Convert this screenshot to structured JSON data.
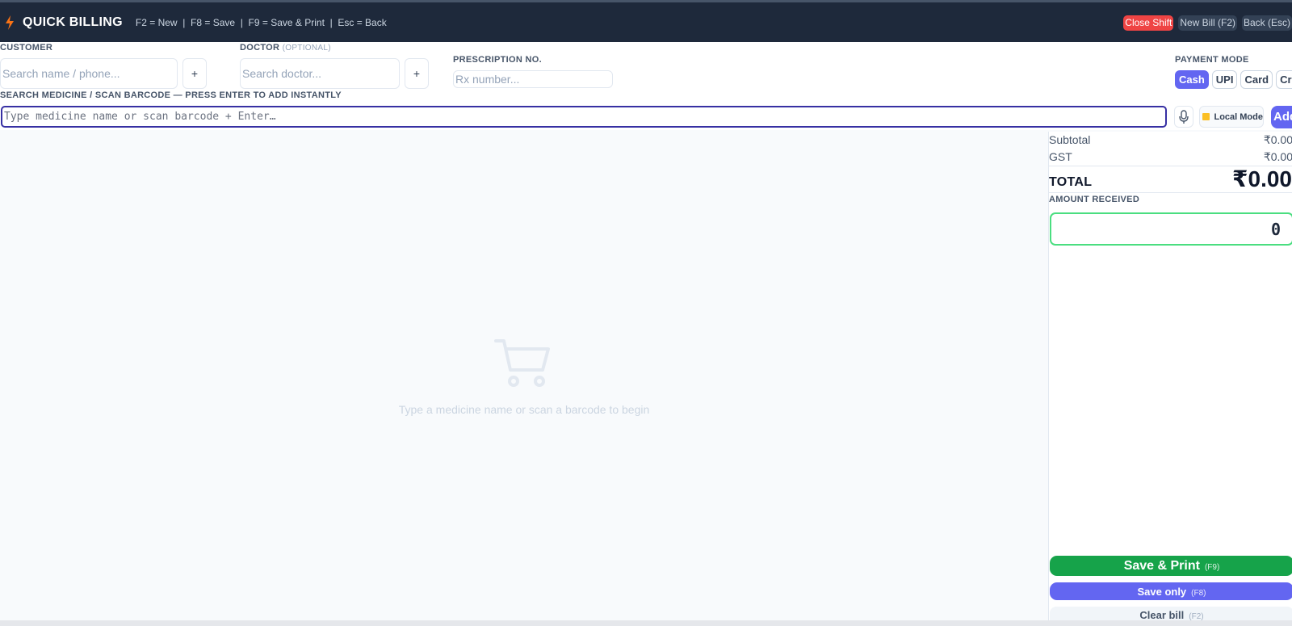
{
  "header": {
    "title": "QUICK BILLING",
    "shortcuts": "F2 = New  |  F8 = Save  |  F9 = Save & Print  |  Esc = Back",
    "buttons": {
      "close_shift": "Close Shift",
      "new_bill": "New Bill (F2)",
      "back": "Back (Esc)"
    }
  },
  "customer": {
    "label": "CUSTOMER",
    "placeholder": "Search name / phone...",
    "add_label": "+"
  },
  "doctor": {
    "label": "DOCTOR",
    "optional": "(OPTIONAL)",
    "placeholder": "Search doctor...",
    "add_label": "+"
  },
  "prescription": {
    "label": "PRESCRIPTION NO.",
    "placeholder": "Rx number..."
  },
  "payment": {
    "label": "PAYMENT MODE",
    "modes": [
      "Cash",
      "UPI",
      "Card",
      "Credit"
    ],
    "selected": "Cash"
  },
  "search": {
    "label": "SEARCH MEDICINE / SCAN BARCODE — PRESS ENTER TO ADD INSTANTLY",
    "placeholder": "Type medicine name or scan barcode + Enter…",
    "local_mode": "Local Mode",
    "add_label": "Add"
  },
  "cart": {
    "empty_text": "Type a medicine name or scan a barcode to begin"
  },
  "summary": {
    "subtotal_label": "Subtotal",
    "subtotal_value": "₹0.00",
    "gst_label": "GST",
    "gst_value": "₹0.00",
    "total_label": "TOTAL",
    "total_value": "₹0.00",
    "amount_received_label": "AMOUNT RECEIVED",
    "amount_received_value": "0"
  },
  "actions": {
    "save_print": "Save & Print",
    "save_print_key": "(F9)",
    "save_only": "Save only",
    "save_only_key": "(F8)",
    "clear_bill": "Clear bill",
    "clear_bill_key": "(F2)"
  },
  "colors": {
    "header_bg": "#1e293b",
    "accent": "#6366f1",
    "danger": "#ef4444",
    "success": "#16a34a"
  }
}
